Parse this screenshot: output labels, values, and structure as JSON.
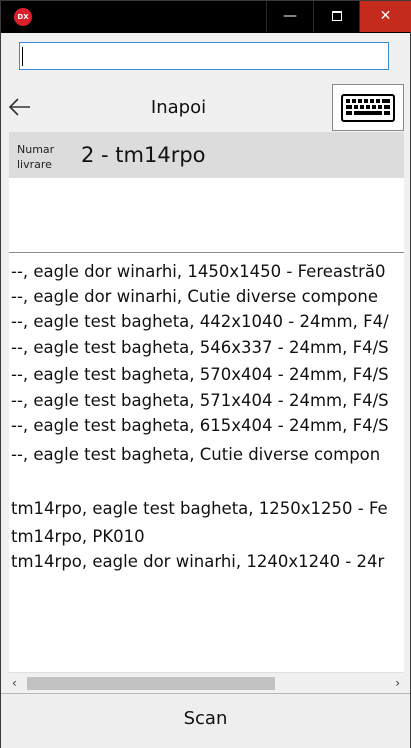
{
  "titlebar": {
    "app_icon_text": "DX",
    "minimize_glyph": "—",
    "close_glyph": "✕",
    "icons": [
      "app-icon",
      "minimize-icon",
      "maximize-icon",
      "close-icon"
    ],
    "close_color": "#c42b1c"
  },
  "search": {
    "value": "",
    "placeholder": ""
  },
  "nav": {
    "back_label": "Inapoi",
    "icons": [
      "arrow-left-icon",
      "keyboard-icon"
    ]
  },
  "delivery": {
    "caption_line1": "Numar",
    "caption_line2": "livrare",
    "value": "2 - tm14rpo"
  },
  "items": [
    "--, eagle dor winarhi, 1450x1450 - Fereastră0",
    "--, eagle dor winarhi, Cutie diverse compone",
    "--, eagle test bagheta, 442x1040 - 24mm, F4/",
    "--, eagle test bagheta, 546x337 - 24mm, F4/S",
    "--, eagle test bagheta, 570x404 - 24mm, F4/S",
    "--, eagle test bagheta, 571x404 - 24mm, F4/S",
    "--, eagle test bagheta, 615x404 - 24mm, F4/S",
    "--, eagle test bagheta, Cutie diverse compon",
    "",
    "tm14rpo, eagle test bagheta, 1250x1250 - Fe",
    "tm14rpo, PK010",
    "tm14rpo, eagle dor winarhi, 1240x1240 - 24r"
  ],
  "scrollbar": {
    "left_arrow": "‹",
    "right_arrow": "›"
  },
  "scan": {
    "label": "Scan"
  }
}
